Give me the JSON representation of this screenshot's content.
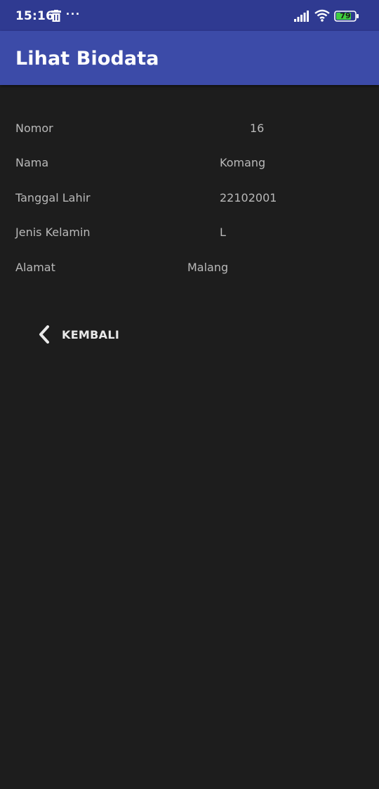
{
  "status_bar": {
    "time": "15:16",
    "notification_icons": [
      "trash-icon"
    ],
    "more_indicator": "···",
    "battery_level": "79",
    "icons": [
      "signal-icon",
      "wifi-icon",
      "battery-icon"
    ],
    "background_color": "#2f3a91"
  },
  "app_bar": {
    "title": "Lihat Biodata",
    "background_color": "#3c4ba8"
  },
  "biodata": [
    {
      "label": "Nomor",
      "value": "16"
    },
    {
      "label": "Nama",
      "value": "Komang"
    },
    {
      "label": "Tanggal Lahir",
      "value": "22102001"
    },
    {
      "label": "Jenis Kelamin",
      "value": "L"
    },
    {
      "label": "Alamat",
      "value": "Malang"
    }
  ],
  "back_button": {
    "label": "KEMBALI",
    "icon": "chevron-left-icon"
  },
  "colors": {
    "background": "#1d1d1d",
    "text_secondary": "#b9b9b9",
    "text_primary": "#ffffff"
  }
}
